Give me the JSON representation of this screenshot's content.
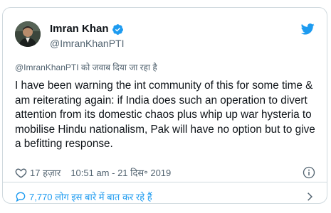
{
  "author": {
    "name": "Imran Khan",
    "handle": "@ImranKhanPTI"
  },
  "reply_to": "@ImranKhanPTI को जवाब दिया जा रहा है",
  "tweet": {
    "text": "I have been warning the int community of this for some time & am reiterating again: if India does such an operation to divert attention from its domestic chaos plus whip up war hysteria to mobilise Hindu nationalism, Pak will have no option but to give a befitting response."
  },
  "meta": {
    "likes": "17 हज़ार",
    "timestamp": "10:51 am - 21 दिस॰ 2019"
  },
  "conversation": {
    "label": "7,770 लोग इस बारे में बात कर रहे हैं"
  },
  "colors": {
    "accent": "#1d9bf0",
    "text": "#0f1419",
    "muted": "#536471",
    "border": "#cfd9de"
  },
  "icons": [
    "verified-badge-icon",
    "twitter-bird-icon",
    "heart-icon",
    "info-icon",
    "speech-bubble-icon",
    "chevron-right-icon"
  ]
}
